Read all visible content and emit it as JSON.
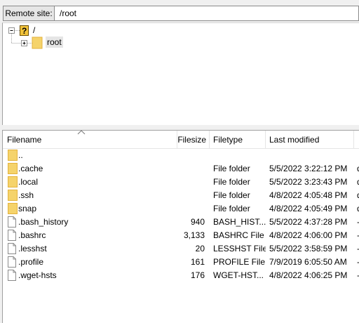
{
  "remote": {
    "label": "Remote site:",
    "path": "/root"
  },
  "tree": {
    "root_label": "/",
    "child_label": "root"
  },
  "columns": {
    "filename": "Filename",
    "filesize": "Filesize",
    "filetype": "Filetype",
    "modified": "Last modified"
  },
  "files": [
    {
      "name": "..",
      "size": "",
      "type": "",
      "modified": "",
      "more": "",
      "icon": "folder-icon"
    },
    {
      "name": ".cache",
      "size": "",
      "type": "File folder",
      "modified": "5/5/2022 3:22:12 PM",
      "more": "d",
      "icon": "folder-icon"
    },
    {
      "name": ".local",
      "size": "",
      "type": "File folder",
      "modified": "5/5/2022 3:23:43 PM",
      "more": "d",
      "icon": "folder-icon"
    },
    {
      "name": ".ssh",
      "size": "",
      "type": "File folder",
      "modified": "4/8/2022 4:05:48 PM",
      "more": "d",
      "icon": "folder-icon"
    },
    {
      "name": "snap",
      "size": "",
      "type": "File folder",
      "modified": "4/8/2022 4:05:49 PM",
      "more": "d",
      "icon": "folder-icon"
    },
    {
      "name": ".bash_history",
      "size": "940",
      "type": "BASH_HIST...",
      "modified": "5/5/2022 4:37:28 PM",
      "more": "-",
      "icon": "file-icon"
    },
    {
      "name": ".bashrc",
      "size": "3,133",
      "type": "BASHRC File",
      "modified": "4/8/2022 4:06:00 PM",
      "more": "-",
      "icon": "file-icon"
    },
    {
      "name": ".lesshst",
      "size": "20",
      "type": "LESSHST File",
      "modified": "5/5/2022 3:58:59 PM",
      "more": "-",
      "icon": "file-icon"
    },
    {
      "name": ".profile",
      "size": "161",
      "type": "PROFILE File",
      "modified": "7/9/2019 6:05:50 AM",
      "more": "-",
      "icon": "file-icon"
    },
    {
      "name": ".wget-hsts",
      "size": "176",
      "type": "WGET-HST...",
      "modified": "4/8/2022 4:06:25 PM",
      "more": "-",
      "icon": "file-icon"
    }
  ],
  "colors": {
    "folder": "#f5d36b",
    "folder_dark": "#e3b23c",
    "border": "#a0a0a0",
    "selection": "#e5e5e5"
  }
}
